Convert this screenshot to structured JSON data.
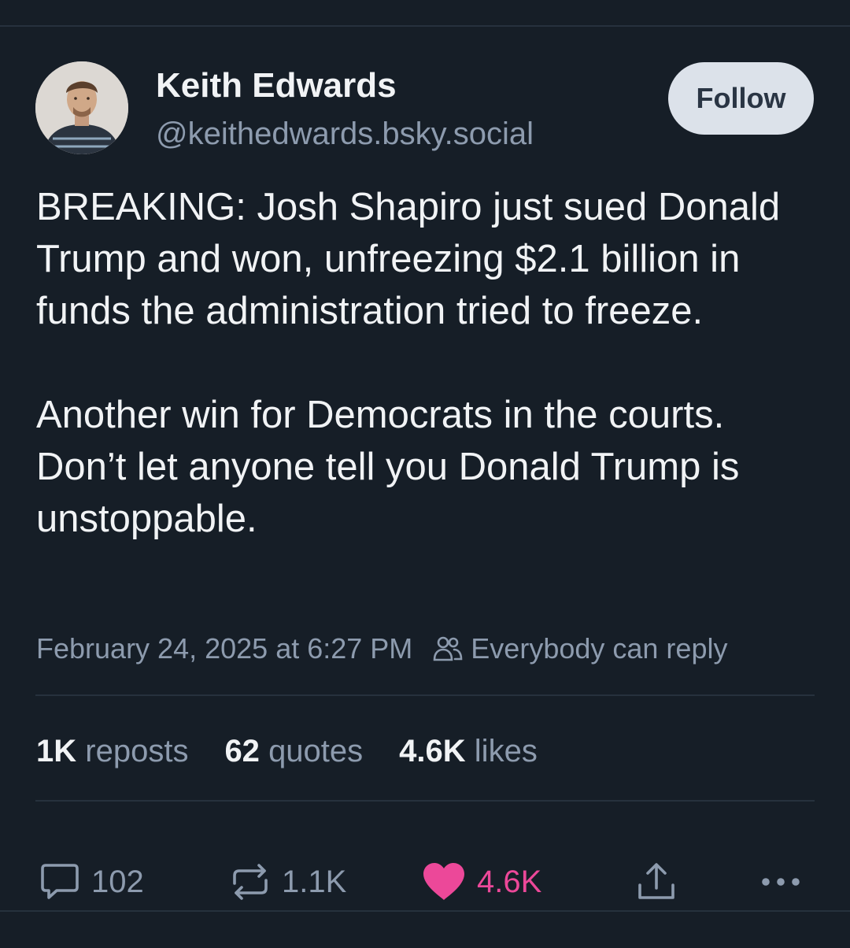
{
  "author": {
    "name": "Keith Edwards",
    "handle": "@keithedwards.bsky.social",
    "avatar_icon": "avatar-photo"
  },
  "follow_label": "Follow",
  "post": {
    "paragraphs": [
      "BREAKING: Josh Shapiro just sued Donald Trump and won, unfreezing $2.1 billion in funds the administration tried to freeze.",
      "Another win for Democrats in the courts. Don’t let anyone tell you Donald Trump is unstoppable."
    ],
    "timestamp": "February 24, 2025 at 6:27 PM",
    "reply_setting": "Everybody can reply"
  },
  "stats": [
    {
      "count": "1K",
      "label": "reposts"
    },
    {
      "count": "62",
      "label": "quotes"
    },
    {
      "count": "4.6K",
      "label": "likes"
    }
  ],
  "actions": {
    "reply": {
      "icon": "reply-bubble-icon",
      "count": "102"
    },
    "repost": {
      "icon": "repost-icon",
      "count": "1.1K"
    },
    "like": {
      "icon": "heart-icon",
      "count": "4.6K",
      "active": true,
      "color": "#ec4899"
    },
    "share": {
      "icon": "share-icon"
    },
    "more": {
      "icon": "more-horizontal-icon"
    }
  },
  "colors": {
    "background": "#161e27",
    "text": "#f1f3f5",
    "muted": "#8d9bae",
    "divider": "#26313d",
    "follow_bg": "#dce2ea"
  }
}
